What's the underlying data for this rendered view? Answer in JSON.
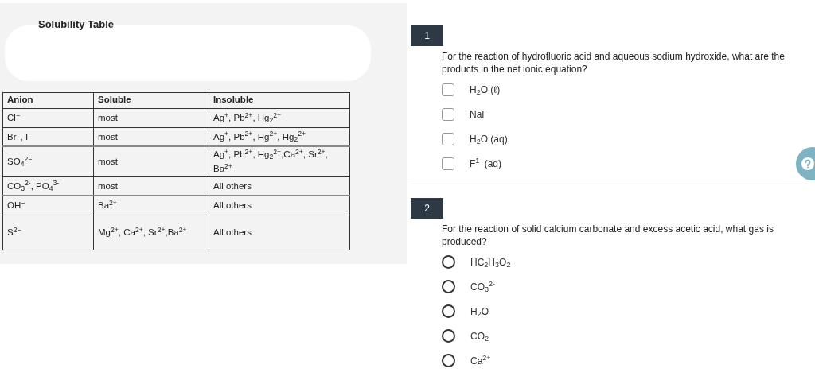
{
  "reference": {
    "title": "Solubility Table",
    "table": {
      "columns": [
        "Anion",
        "Soluble",
        "Insoluble"
      ],
      "rows": [
        [
          "Cl$^{−}$",
          "most",
          "Ag$^{+}$, Pb$^{2+}$, Hg$_{2}$$^{2+}$"
        ],
        [
          "Br$^{−}$, I$^{−}$",
          "most",
          "Ag$^{+}$, Pb$^{2+}$, Hg$^{2+}$, Hg$_{2}$$^{2+}$"
        ],
        [
          "SO$_{4}$$^{2−}$",
          "most",
          "Ag$^{+}$, Pb$^{2+}$, Hg$_{2}$$^{2+}$,Ca$^{2+}$, Sr$^{2+}$, Ba$^{2+}$"
        ],
        [
          "CO$_{3}$$^{2-}$, PO$_{4}$$^{3-}$",
          "most",
          "All others"
        ],
        [
          "OH$^{−}$",
          "Ba$^{2+}$",
          "All others"
        ],
        [
          "S$^{2−}$",
          "Mg$^{2+}$, Ca$^{2+}$, Sr$^{2+}$,Ba$^{2+}$",
          "All others"
        ]
      ]
    }
  },
  "questions": [
    {
      "number": "1",
      "kind": "checkbox",
      "text": "For the reaction of hydrofluoric acid and aqueous sodium hydroxide, what are the products in the net ionic equation?",
      "options": [
        {
          "label": "H$_{2}$O (ℓ)",
          "checked": false
        },
        {
          "label": "NaF",
          "checked": false
        },
        {
          "label": "H$_{2}$O (aq)",
          "checked": false
        },
        {
          "label": "F$^{1-}$ (aq)",
          "checked": false
        }
      ]
    },
    {
      "number": "2",
      "kind": "radio",
      "text": "For the reaction of solid calcium carbonate and excess acetic acid, what gas is produced?",
      "options": [
        {
          "label": "HC$_{2}$H$_{3}$O$_{2}$",
          "selected": false
        },
        {
          "label": "CO$_{3}$$^{2-}$",
          "selected": false
        },
        {
          "label": "H$_{2}$O",
          "selected": false
        },
        {
          "label": "CO$_{2}$",
          "selected": false
        },
        {
          "label": "Ca$^{2+}$",
          "selected": false
        }
      ]
    }
  ]
}
